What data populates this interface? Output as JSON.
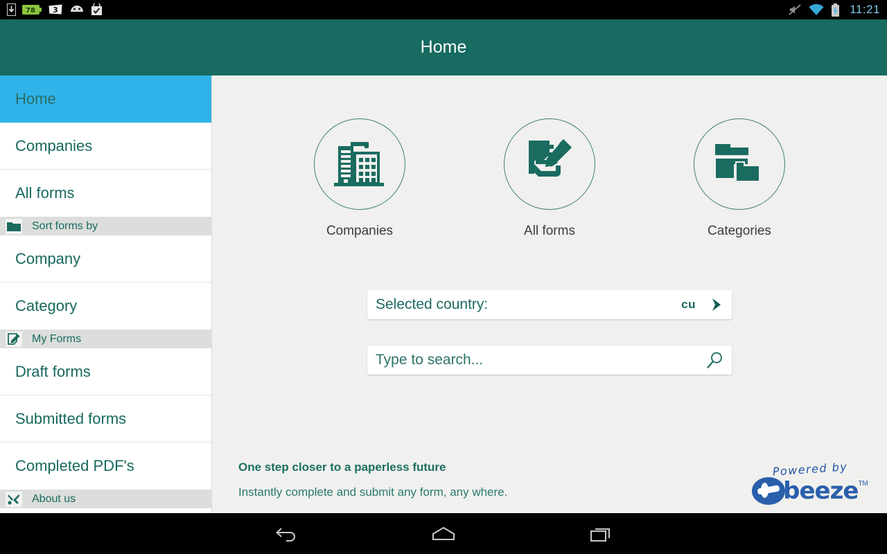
{
  "statusbar": {
    "left_icons": [
      "download-icon",
      "battery-level-icon",
      "notification-count-icon",
      "android-icon",
      "checkmark-bag-icon"
    ],
    "battery_level": "78",
    "notification_count": "3",
    "right_icons": [
      "volume-muted-icon",
      "wifi-icon",
      "battery-charging-icon"
    ],
    "clock": "11:21"
  },
  "appbar": {
    "title": "Home"
  },
  "sidebar": {
    "items": [
      {
        "label": "Home",
        "selected": true,
        "type": "item"
      },
      {
        "label": "Companies",
        "selected": false,
        "type": "item"
      },
      {
        "label": "All forms",
        "selected": false,
        "type": "item"
      },
      {
        "label": "Sort forms by",
        "type": "section",
        "icon": "folder-icon"
      },
      {
        "label": "Company",
        "selected": false,
        "type": "item"
      },
      {
        "label": "Category",
        "selected": false,
        "type": "item"
      },
      {
        "label": "My Forms",
        "type": "section",
        "icon": "form-pencil-icon"
      },
      {
        "label": "Draft forms",
        "selected": false,
        "type": "item"
      },
      {
        "label": "Submitted forms",
        "selected": false,
        "type": "item"
      },
      {
        "label": "Completed PDF's",
        "selected": false,
        "type": "item"
      },
      {
        "label": "About us",
        "type": "section",
        "icon": "tools-icon"
      }
    ]
  },
  "main": {
    "shortcuts": [
      {
        "label": "Companies",
        "icon": "buildings-icon"
      },
      {
        "label": "All forms",
        "icon": "form-pencil-icon"
      },
      {
        "label": "Categories",
        "icon": "folders-icon"
      }
    ],
    "country_field": {
      "label": "Selected country:",
      "value": "cu",
      "icon": "chevron-right-icon"
    },
    "search_field": {
      "placeholder": "Type to search...",
      "value": "",
      "icon": "search-icon"
    },
    "tagline": {
      "headline": "One step closer to a paperless future",
      "subline": "Instantly complete and submit any form, any where."
    },
    "branding": {
      "powered_by": "Powered by",
      "logo_word": "beeze",
      "trademark": "TM"
    }
  },
  "navbar": {
    "buttons": [
      {
        "name": "back-button",
        "icon": "back-arrow-icon"
      },
      {
        "name": "home-button",
        "icon": "home-icon"
      },
      {
        "name": "recents-button",
        "icon": "recents-icon"
      }
    ]
  },
  "colors": {
    "appbar_teal": "#176B60",
    "selected_blue": "#2FB3E8",
    "content_bg": "#F0F0EE",
    "accent_green": "#18695F",
    "logo_blue": "#2A5FAB"
  }
}
